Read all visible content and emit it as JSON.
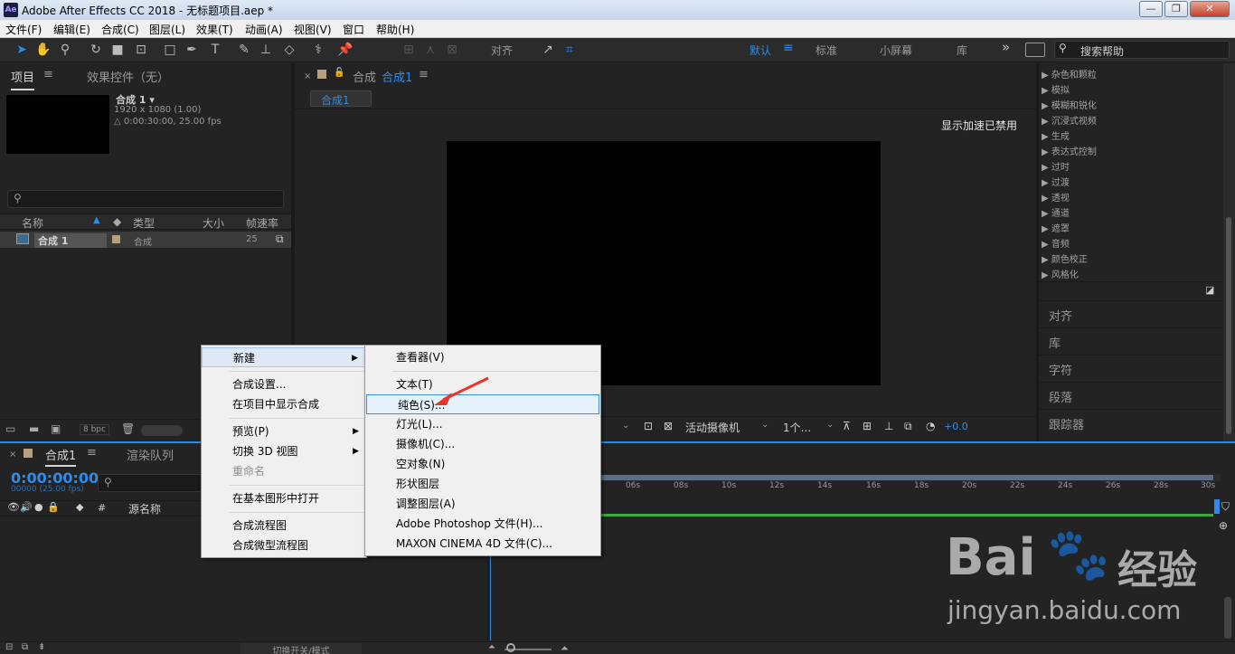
{
  "window": {
    "logo": "Ae",
    "title": "Adobe After Effects CC 2018 - 无标题项目.aep *",
    "min": "0",
    "max": "1",
    "close": "r"
  },
  "menubar": [
    "文件(F)",
    "编辑(E)",
    "合成(C)",
    "图层(L)",
    "效果(T)",
    "动画(A)",
    "视图(V)",
    "窗口",
    "帮助(H)"
  ],
  "toolbar": {
    "align_label": "对齐",
    "workspaces": [
      "默认",
      "标准",
      "小屏幕",
      "库"
    ],
    "more": "»",
    "help_search_placeholder": "搜索帮助"
  },
  "project_panel": {
    "tabs": [
      "项目",
      "效果控件（无）"
    ],
    "comp_name": "合成 1 ▾",
    "comp_size": "1920 x 1080 (1.00)",
    "comp_duration": "△ 0:00:30:00, 25.00 fps",
    "columns": [
      "名称",
      "类型",
      "大小",
      "帧速率"
    ],
    "row": {
      "name": "合成 1",
      "type": "合成",
      "fps": "25"
    },
    "bpc": "8 bpc"
  },
  "composition_panel": {
    "tab_label": "合成",
    "tab_name": "合成1",
    "flow_label": "合成1",
    "gpu_notice": "显示加速已禁用",
    "camera": "活动摄像机",
    "views": "1个...",
    "exposure": "+0.0"
  },
  "effects_panel": {
    "items": [
      "杂色和颗粒",
      "模拟",
      "模糊和锐化",
      "沉浸式视频",
      "生成",
      "表达式控制",
      "过时",
      "过渡",
      "透视",
      "通道",
      "遮罩",
      "音频",
      "颜色校正",
      "风格化"
    ],
    "sections": [
      "对齐",
      "库",
      "字符",
      "段落",
      "跟踪器"
    ]
  },
  "timeline": {
    "tabs": [
      "合成1",
      "渲染队列"
    ],
    "timecode": "0:00:00:00",
    "timecode_sub": "00000 (25.00 fps)",
    "column_hash": "#",
    "column_source": "源名称",
    "ticks": [
      "06s",
      "08s",
      "10s",
      "12s",
      "14s",
      "16s",
      "18s",
      "20s",
      "22s",
      "24s",
      "26s",
      "28s",
      "30s"
    ],
    "toggle_label": "切换开关/模式"
  },
  "context_menu": {
    "items": [
      {
        "label": "新建",
        "submenu": true
      },
      {
        "label": "合成设置..."
      },
      {
        "label": "在项目中显示合成"
      },
      {
        "label": "预览(P)",
        "submenu": true
      },
      {
        "label": "切换 3D 视图",
        "submenu": true
      },
      {
        "label": "重命名",
        "disabled": true
      },
      {
        "label": "在基本图形中打开"
      },
      {
        "label": "合成流程图"
      },
      {
        "label": "合成微型流程图"
      }
    ]
  },
  "submenu": {
    "items": [
      "查看器(V)",
      "文本(T)",
      "纯色(S)...",
      "灯光(L)...",
      "摄像机(C)...",
      "空对象(N)",
      "形状图层",
      "调整图层(A)",
      "Adobe Photoshop 文件(H)...",
      "MAXON CINEMA 4D 文件(C)..."
    ],
    "highlighted": "纯色(S)..."
  },
  "watermark": {
    "brand": "Bai",
    "brand2": "经验",
    "url": "jingyan.baidu.com"
  },
  "colors": {
    "accent": "#2d8ceb",
    "panel_bg": "#232323",
    "menu_bg": "#f0f0f0",
    "arrow": "#e8342b"
  }
}
